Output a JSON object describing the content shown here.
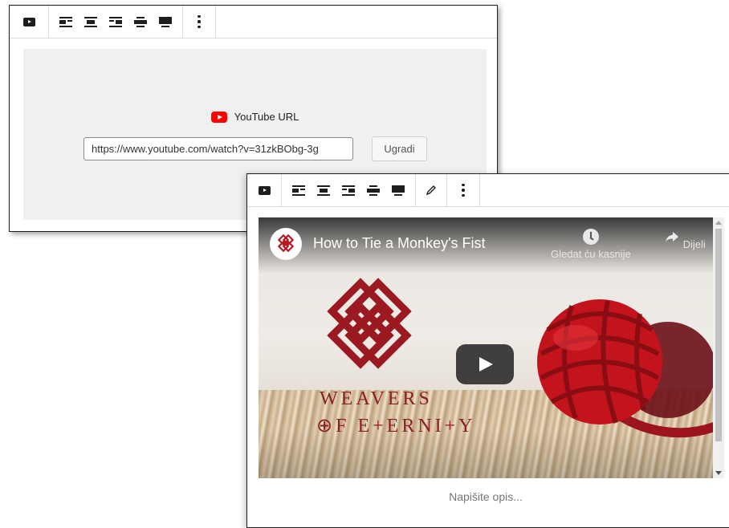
{
  "block1": {
    "toolbar": {
      "embed_icon": "video-embed-icon",
      "align_icons": [
        "align-left-icon",
        "align-center-icon",
        "align-right-icon",
        "align-wide-icon",
        "align-full-icon"
      ],
      "more_icon": "more-options-icon"
    },
    "placeholder": {
      "label": "YouTube URL",
      "url_value": "https://www.youtube.com/watch?v=31zkBObg-3g",
      "embed_button": "Ugradi",
      "brand_color": "#ff0000"
    }
  },
  "block2": {
    "toolbar": {
      "embed_icon": "video-embed-icon",
      "align_icons": [
        "align-left-icon",
        "align-center-icon",
        "align-right-icon",
        "align-wide-icon",
        "align-full-icon"
      ],
      "edit_icon": "pencil-icon",
      "more_icon": "more-options-icon"
    },
    "video": {
      "title": "How to Tie a Monkey's Fist",
      "watch_later": "Gledat ću kasnije",
      "share": "Dijeli",
      "brand_line1": "WEAVERS",
      "brand_line2": "⊕F E+ERNI+Y",
      "accent_color": "#c0161f"
    },
    "caption_placeholder": "Napišite opis..."
  }
}
